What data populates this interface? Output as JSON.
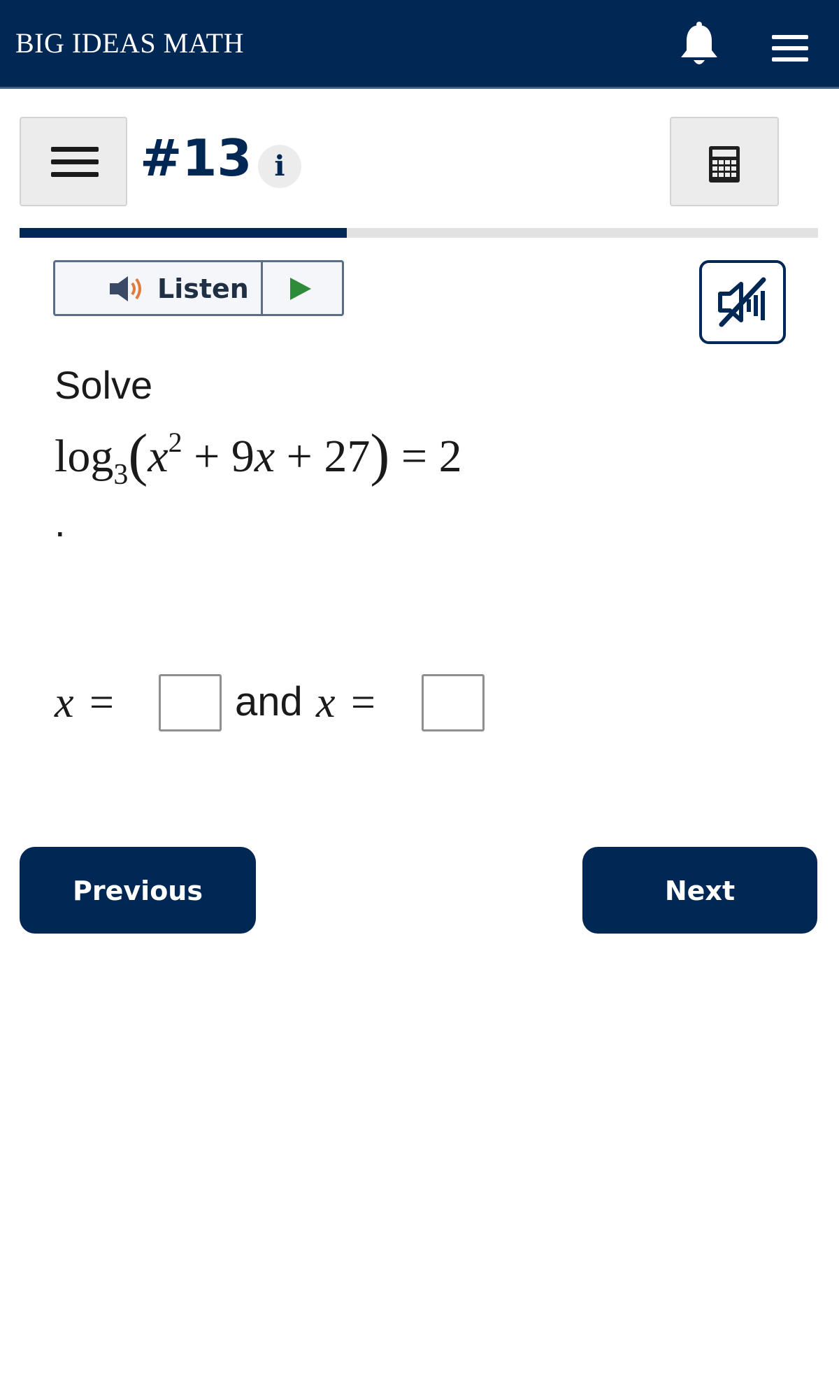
{
  "header": {
    "brand": "BIG IDEAS MATH",
    "notification_icon": "bell-icon",
    "menu_icon": "hamburger-menu-icon",
    "background_color": "#012754"
  },
  "question_bar": {
    "menu_icon": "hamburger-menu-icon",
    "number": "#13",
    "info_label": "i",
    "calculator_icon": "calculator-icon",
    "progress_fraction": 0.41
  },
  "audio": {
    "listen_label": "Listen",
    "speaker_icon": "speaker-icon",
    "play_icon": "play-icon",
    "mute_icon": "speaker-muted-icon"
  },
  "problem": {
    "prompt": "Solve",
    "equation": {
      "func": "log",
      "base": "3",
      "var": "x",
      "exp": "2",
      "rest": " + 9",
      "rest2": " + 27",
      "rhs": " = 2"
    },
    "trailing": "."
  },
  "answer": {
    "var": "x",
    "equals": "=",
    "conjunction": "and",
    "first_value": "",
    "second_value": ""
  },
  "navigation": {
    "previous_label": "Previous",
    "next_label": "Next"
  },
  "colors": {
    "primary": "#012754",
    "play": "#2e8b3a",
    "speaker_wave": "#e07b39"
  }
}
